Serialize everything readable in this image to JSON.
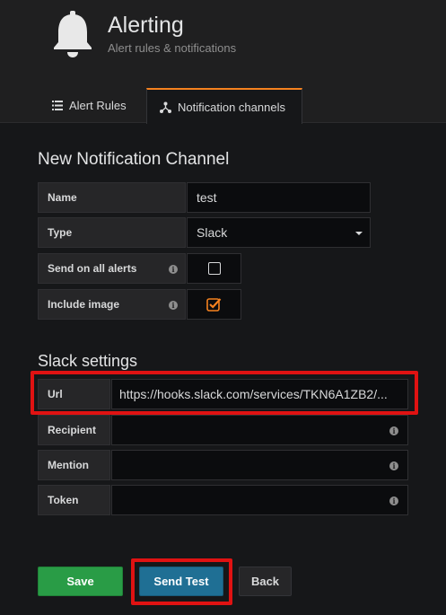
{
  "header": {
    "title": "Alerting",
    "subtitle": "Alert rules & notifications"
  },
  "tabs": [
    {
      "label": "Alert Rules",
      "icon": "list-icon",
      "active": false
    },
    {
      "label": "Notification channels",
      "icon": "share-nodes-icon",
      "active": true
    }
  ],
  "form": {
    "title": "New Notification Channel",
    "name": {
      "label": "Name",
      "value": "test"
    },
    "type": {
      "label": "Type",
      "value": "Slack"
    },
    "send_all": {
      "label": "Send on all alerts",
      "checked": false
    },
    "include_image": {
      "label": "Include image",
      "checked": true
    }
  },
  "slack": {
    "title": "Slack settings",
    "url": {
      "label": "Url",
      "value": "https://hooks.slack.com/services/TKN6A1ZB2/..."
    },
    "recipient": {
      "label": "Recipient",
      "value": ""
    },
    "mention": {
      "label": "Mention",
      "value": ""
    },
    "token": {
      "label": "Token",
      "value": ""
    }
  },
  "buttons": {
    "save": "Save",
    "send_test": "Send Test",
    "back": "Back"
  },
  "colors": {
    "accent_orange": "#f5821f",
    "save_green": "#299c46",
    "test_blue": "#1f6f94",
    "highlight_red": "#e01212"
  }
}
